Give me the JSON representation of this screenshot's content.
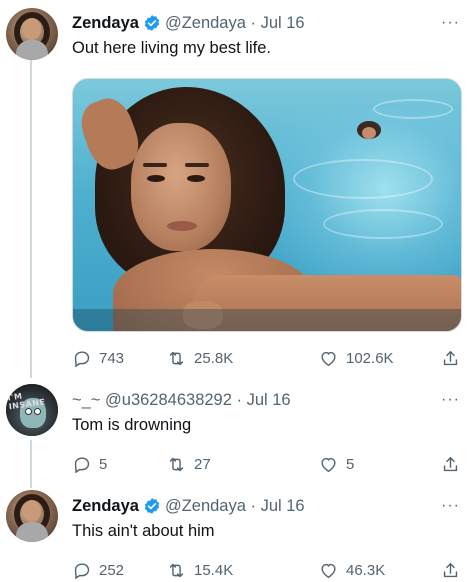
{
  "tweets": [
    {
      "name": "Zendaya",
      "handle": "@Zendaya · Jul 16",
      "text": "Out here living my best life.",
      "replies": "743",
      "retweets": "25.8K",
      "likes": "102.6K"
    },
    {
      "name": "",
      "handle": "~_~ @u36284638292 · Jul 16",
      "text": "Tom is drowning",
      "replies": "5",
      "retweets": "27",
      "likes": "5"
    },
    {
      "name": "Zendaya",
      "handle": "@Zendaya · Jul 16",
      "text": "This ain't about him",
      "replies": "252",
      "retweets": "15.4K",
      "likes": "46.3K"
    }
  ],
  "avatar_text": "I'M INSANE",
  "more_label": "···",
  "icons": [
    "reply-icon",
    "retweet-icon",
    "like-icon",
    "share-icon",
    "verified-icon",
    "more-icon"
  ],
  "colors": {
    "verified": "#1d9bf0",
    "secondary_text": "#536471",
    "thread_line": "#cfd9de"
  }
}
